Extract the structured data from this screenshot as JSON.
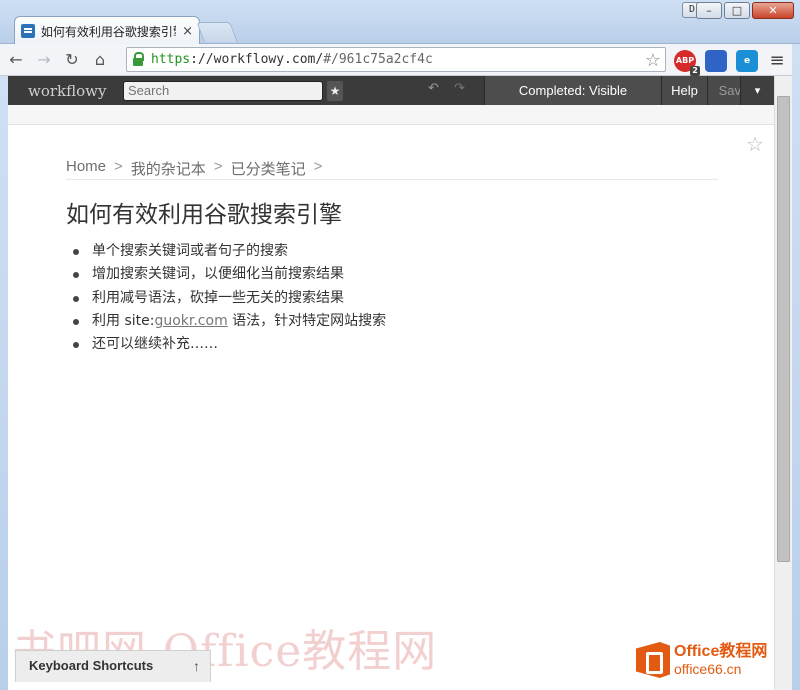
{
  "browser": {
    "tab_title": "如何有效利用谷歌搜索引擎",
    "tab_close": "×",
    "user_badge": "Di",
    "window_controls": {
      "minimize": "–",
      "maximize": "□",
      "close": "✕"
    },
    "nav": {
      "back": "←",
      "forward": "→",
      "reload": "↻",
      "home": "⌂"
    },
    "url": {
      "scheme": "https",
      "rest": "://workflowy.com/",
      "path": "#/961c75a2cf4c"
    },
    "extensions": {
      "abp_label": "ABP",
      "abp_count": "2"
    },
    "menu_icon": "≡",
    "bookmark_star": "☆"
  },
  "workflowy": {
    "logo": "workflowy",
    "search_placeholder": "Search",
    "star_label": "★",
    "undo_icon": "↶",
    "redo_icon": "↷",
    "completed_label": "Completed: Visible",
    "help_label": "Help",
    "saved_label": "Saved",
    "dropdown_icon": "▾"
  },
  "page": {
    "star": "☆",
    "breadcrumb": [
      "Home",
      "我的杂记本",
      "已分类笔记"
    ],
    "breadcrumb_sep": ">",
    "title": "如何有效利用谷歌搜索引擎",
    "items": [
      "单个搜索关键词或者句子的搜索",
      "增加搜索关键词，以便细化当前搜索结果",
      "利用减号语法，砍掉一些无关的搜索结果",
      {
        "prefix": "利用 site:",
        "link": "guokr.com",
        "suffix": " 语法，针对特定网站搜索"
      },
      "还可以继续补充……"
    ]
  },
  "footer": {
    "keyboard_shortcuts": "Keyboard Shortcuts",
    "kbd_arrow": "↑",
    "watermark": "书吧网-Office教程网",
    "office_brand_1": "Office教程网",
    "office_brand_2": "office66.cn"
  }
}
